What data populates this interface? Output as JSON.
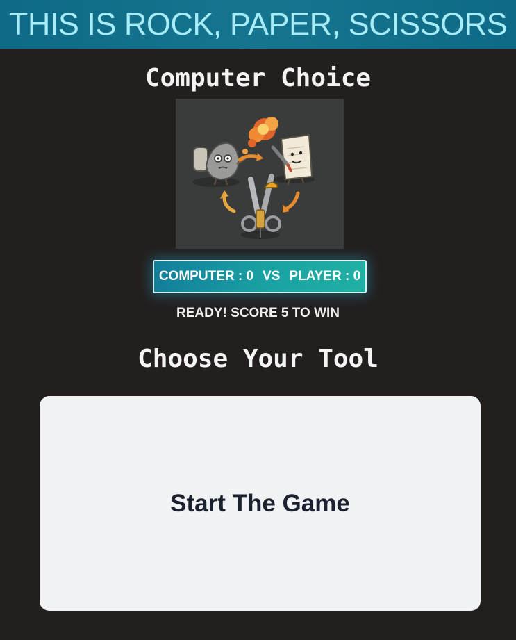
{
  "header": {
    "title": "THIS IS ROCK, PAPER, SCISSORS"
  },
  "computer": {
    "title": "Computer Choice",
    "image_icon": "rock-paper-scissors-cycle-illustration"
  },
  "scoreboard": {
    "computer_label": "COMPUTER : 0",
    "vs_label": "VS",
    "player_label": "PLAYER : 0"
  },
  "status": {
    "message": "READY! SCORE 5 TO WIN"
  },
  "tools": {
    "title": "Choose Your Tool",
    "start_label": "Start The Game"
  },
  "colors": {
    "background": "#231f1f",
    "banner": "#0e6a86",
    "banner_text": "#a8ecf7",
    "panel": "#f1f2f4",
    "panel_text": "#1c2130",
    "score_gradient_start": "#137e9a",
    "score_gradient_end": "#20b0a3"
  }
}
